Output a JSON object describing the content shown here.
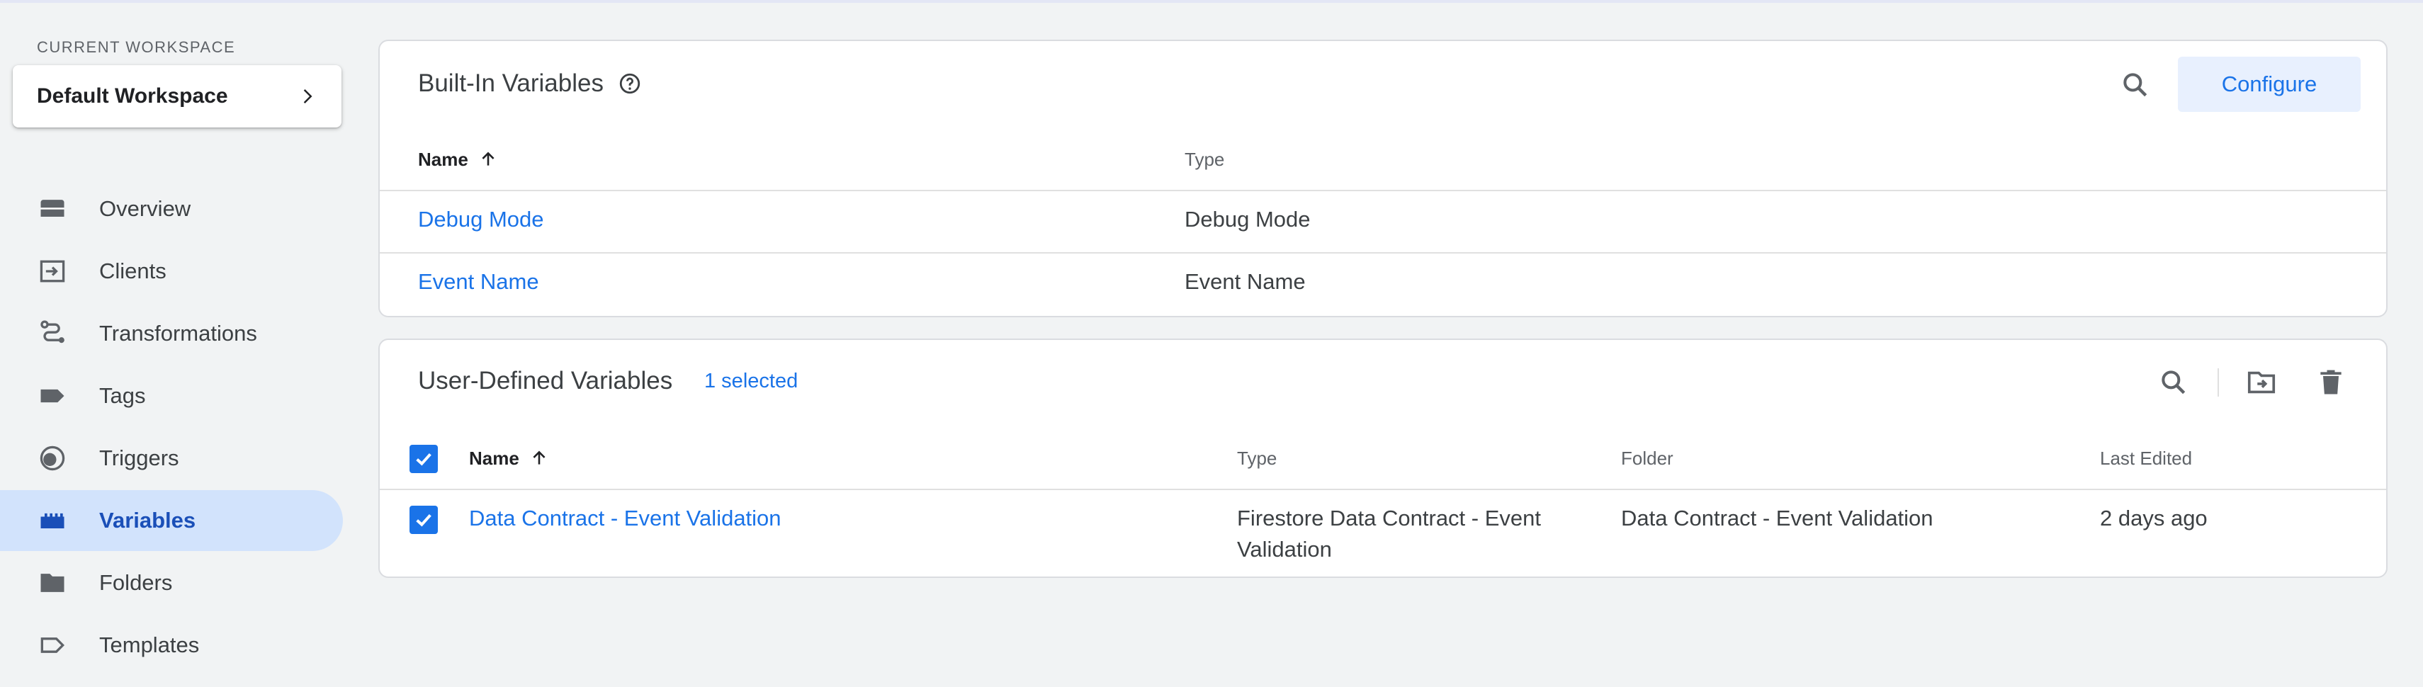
{
  "workspace": {
    "caption": "CURRENT WORKSPACE",
    "name": "Default Workspace"
  },
  "nav": {
    "items": [
      {
        "label": "Overview",
        "icon": "overview-icon"
      },
      {
        "label": "Clients",
        "icon": "clients-icon"
      },
      {
        "label": "Transformations",
        "icon": "transformations-icon"
      },
      {
        "label": "Tags",
        "icon": "tag-icon"
      },
      {
        "label": "Triggers",
        "icon": "triggers-icon"
      },
      {
        "label": "Variables",
        "icon": "variables-icon",
        "active": true
      },
      {
        "label": "Folders",
        "icon": "folder-icon"
      },
      {
        "label": "Templates",
        "icon": "templates-icon"
      }
    ]
  },
  "builtin": {
    "title": "Built-In Variables",
    "configure_label": "Configure",
    "columns": {
      "name": "Name",
      "type": "Type"
    },
    "rows": [
      {
        "name": "Debug Mode",
        "type": "Debug Mode"
      },
      {
        "name": "Event Name",
        "type": "Event Name"
      }
    ]
  },
  "userdefined": {
    "title": "User-Defined Variables",
    "selected_text": "1 selected",
    "columns": {
      "name": "Name",
      "type": "Type",
      "folder": "Folder",
      "last_edited": "Last Edited"
    },
    "rows": [
      {
        "name": "Data Contract - Event Validation",
        "type_line1": "Firestore Data Contract - Event",
        "type_line2": "Validation",
        "folder": "Data Contract - Event Validation",
        "last_edited": "2 days ago",
        "checked": true
      }
    ]
  },
  "colors": {
    "accent": "#1a73e8",
    "active_nav_bg": "#d2e3fc",
    "page_bg": "#f1f3f4"
  }
}
